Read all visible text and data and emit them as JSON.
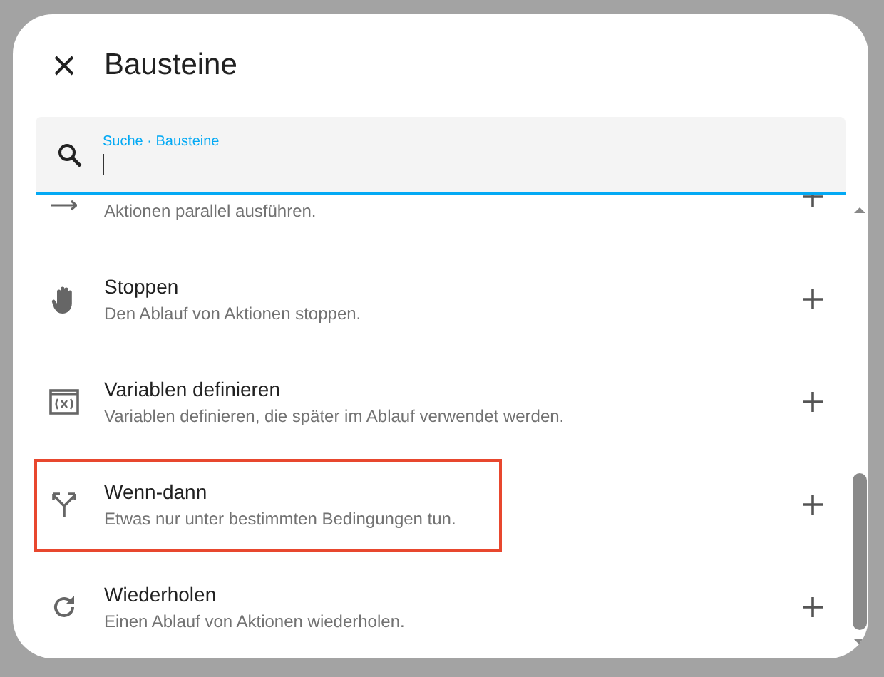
{
  "dialog": {
    "title": "Bausteine"
  },
  "search": {
    "label": "Suche · Bausteine"
  },
  "items": [
    {
      "description": "Aktionen parallel ausführen.",
      "highlighted": false
    },
    {
      "title": "Stoppen",
      "description": "Den Ablauf von Aktionen stoppen.",
      "highlighted": false
    },
    {
      "title": "Variablen definieren",
      "description": "Variablen definieren, die später im Ablauf verwendet werden.",
      "highlighted": false
    },
    {
      "title": "Wenn-dann",
      "description": "Etwas nur unter bestimmten Bedingungen tun.",
      "highlighted": true
    },
    {
      "title": "Wiederholen",
      "description": "Einen Ablauf von Aktionen wiederholen.",
      "highlighted": false
    }
  ]
}
